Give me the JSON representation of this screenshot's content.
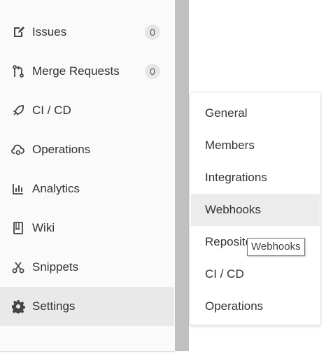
{
  "sidebar": {
    "items": [
      {
        "label": "Issues",
        "count": "0",
        "icon": "issues-icon"
      },
      {
        "label": "Merge Requests",
        "count": "0",
        "icon": "merge-request-icon"
      },
      {
        "label": "CI / CD",
        "icon": "rocket-icon"
      },
      {
        "label": "Operations",
        "icon": "cloud-gear-icon"
      },
      {
        "label": "Analytics",
        "icon": "chart-icon"
      },
      {
        "label": "Wiki",
        "icon": "book-icon"
      },
      {
        "label": "Snippets",
        "icon": "scissors-icon"
      },
      {
        "label": "Settings",
        "icon": "gear-icon",
        "active": true
      }
    ]
  },
  "flyout": {
    "items": [
      {
        "label": "General"
      },
      {
        "label": "Members"
      },
      {
        "label": "Integrations"
      },
      {
        "label": "Webhooks",
        "hovered": true
      },
      {
        "label": "Repository"
      },
      {
        "label": "CI / CD"
      },
      {
        "label": "Operations"
      }
    ]
  },
  "tooltip": {
    "text": "Webhooks"
  },
  "colors": {
    "sidebar_bg": "#fafafa",
    "active_bg": "#e9e9e9",
    "scrollbar": "#c0c0c0",
    "hover_bg": "#ececec"
  }
}
